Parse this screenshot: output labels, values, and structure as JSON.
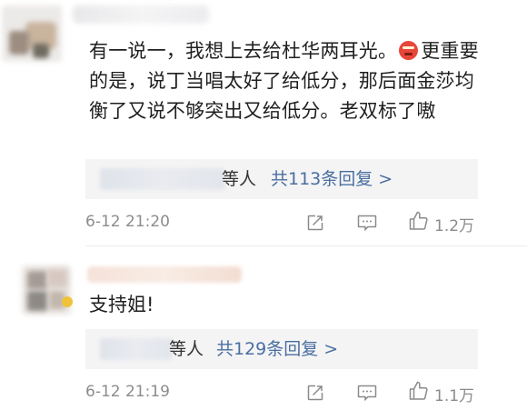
{
  "comments": [
    {
      "text_before_emoji": "有一说一，我想上去给杜华两耳光。",
      "emoji": "angry-face-emoji",
      "text_after_emoji": "更重要的是，说丁当唱太好了给低分，那后面金莎均衡了又说不够突出又给低分。老双标了嗷",
      "reply_who": "等人",
      "reply_link": "共113条回复 >",
      "timestamp": "6-12 21:20",
      "likes": "1.2万"
    },
    {
      "text": "支持姐!",
      "reply_who": "等人",
      "reply_link": "共129条回复 >",
      "timestamp": "6-12 21:19",
      "likes": "1.1万"
    }
  ],
  "colors": {
    "text": "#1f1f1f",
    "link": "#4a6ea0",
    "meta": "#8c8c8c",
    "reply_bg": "#f4f4f5"
  }
}
